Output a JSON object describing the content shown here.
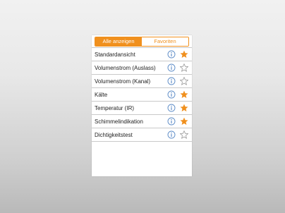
{
  "tabs": [
    {
      "label": "Alle anzeigen",
      "active": true
    },
    {
      "label": "Favoriten",
      "active": false
    }
  ],
  "items": [
    {
      "label": "Standardansicht",
      "favorite": true
    },
    {
      "label": "Volumenstrom (Auslass)",
      "favorite": false
    },
    {
      "label": "Volumenstrom (Kanal)",
      "favorite": false
    },
    {
      "label": "Kälte",
      "favorite": true
    },
    {
      "label": "Temperatur (IR)",
      "favorite": true
    },
    {
      "label": "Schimmelindikation",
      "favorite": true
    },
    {
      "label": "Dichtigkeitstest",
      "favorite": false
    }
  ],
  "icons": {
    "info": "info-icon",
    "favorite": "star-icon"
  },
  "colors": {
    "accent": "#f0901e",
    "info": "#5a8ac6",
    "star_empty": "#9a9a9a"
  }
}
